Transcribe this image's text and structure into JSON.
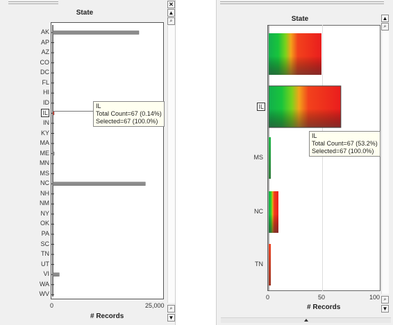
{
  "left_panel": {
    "title": "State",
    "axis_title": "# Records",
    "x_ticks": [
      "0",
      "25,000"
    ],
    "categories": [
      "AK",
      "AP",
      "AZ",
      "CO",
      "DC",
      "FL",
      "HI",
      "ID",
      "IL",
      "IN",
      "KY",
      "MA",
      "ME",
      "MN",
      "MS",
      "NC",
      "NH",
      "NM",
      "NY",
      "OK",
      "PA",
      "SC",
      "TN",
      "UT",
      "VI",
      "WA",
      "WV"
    ],
    "selected_category": "IL",
    "tooltip": {
      "line1": "IL",
      "line2": "Total Count=67 (0.14%)",
      "line3": "Selected=67 (100.0%)"
    },
    "controls": {
      "close": "✕",
      "up": "▲",
      "zoom": "🔍",
      "down": "▼"
    }
  },
  "right_panel": {
    "title": "State",
    "axis_title": "# Records",
    "x_ticks": [
      "0",
      "50",
      "100"
    ],
    "categories": [
      "",
      "IL",
      "MS",
      "NC",
      "TN"
    ],
    "selected_category": "IL",
    "tooltip": {
      "line1": "IL",
      "line2": "Total Count=67 (53.2%)",
      "line3": "Selected=67 (100.0%)"
    },
    "controls": {
      "up": "▲",
      "zoom": "🔍",
      "down": "▼"
    }
  },
  "chart_data": [
    {
      "type": "bar",
      "orientation": "horizontal",
      "title": "State",
      "xlabel": "# Records",
      "xlim": [
        0,
        25000
      ],
      "categories": [
        "AK",
        "AP",
        "AZ",
        "CO",
        "DC",
        "FL",
        "HI",
        "ID",
        "IL",
        "IN",
        "KY",
        "MA",
        "ME",
        "MN",
        "MS",
        "NC",
        "NH",
        "NM",
        "NY",
        "OK",
        "PA",
        "SC",
        "TN",
        "UT",
        "VI",
        "WA",
        "WV"
      ],
      "values": [
        20000,
        0,
        0,
        0,
        0,
        0,
        0,
        0,
        67,
        0,
        0,
        0,
        300,
        0,
        0,
        21500,
        0,
        0,
        0,
        0,
        0,
        0,
        0,
        0,
        1500,
        0,
        0
      ]
    },
    {
      "type": "bar",
      "orientation": "horizontal",
      "title": "State",
      "xlabel": "# Records",
      "xlim": [
        0,
        100
      ],
      "categories": [
        "",
        "IL",
        "MS",
        "NC",
        "TN"
      ],
      "values": [
        49,
        67,
        2,
        9,
        2
      ]
    }
  ]
}
